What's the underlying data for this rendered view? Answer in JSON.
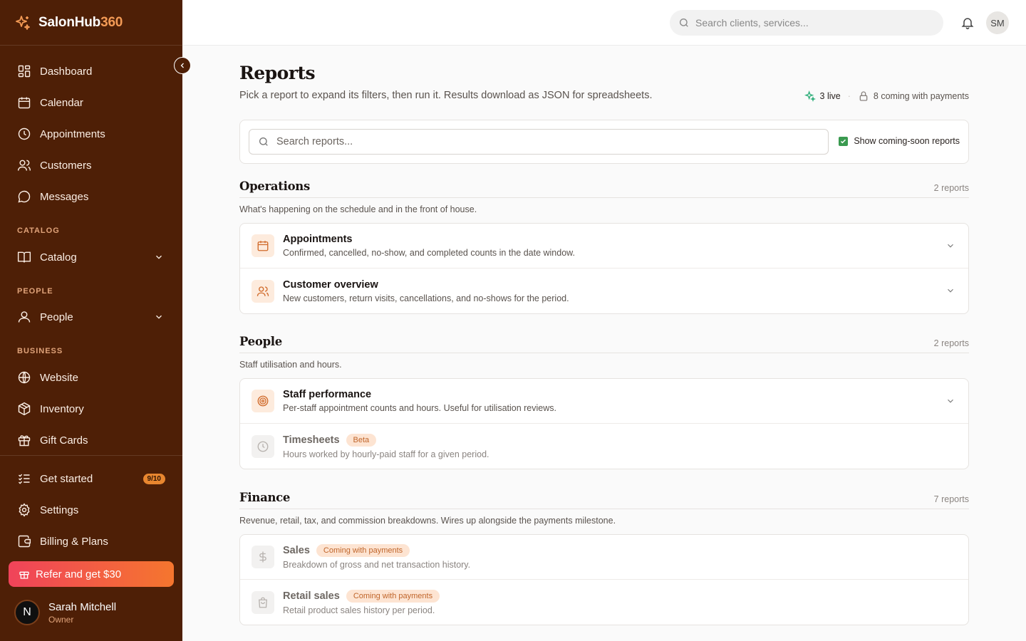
{
  "brand": {
    "name_main": "SalonHub",
    "name_accent": "360"
  },
  "sidebar": {
    "primary": [
      {
        "label": "Dashboard",
        "icon": "dashboard-icon"
      },
      {
        "label": "Calendar",
        "icon": "calendar-icon"
      },
      {
        "label": "Appointments",
        "icon": "clock-icon"
      },
      {
        "label": "Customers",
        "icon": "users-icon"
      },
      {
        "label": "Messages",
        "icon": "message-icon"
      }
    ],
    "sections": {
      "catalog": "CATALOG",
      "people": "PEOPLE",
      "business": "BUSINESS"
    },
    "catalog_item": "Catalog",
    "people_item": "People",
    "business_items": [
      {
        "label": "Website",
        "icon": "globe-icon"
      },
      {
        "label": "Inventory",
        "icon": "box-icon"
      },
      {
        "label": "Gift Cards",
        "icon": "gift-icon"
      }
    ],
    "bottom_items": [
      {
        "label": "Get started",
        "badge": "9/10"
      },
      {
        "label": "Settings"
      },
      {
        "label": "Billing & Plans"
      }
    ],
    "refer_label": "Refer and get $30",
    "user": {
      "initial": "N",
      "name": "Sarah Mitchell",
      "role": "Owner"
    }
  },
  "topbar": {
    "search_placeholder": "Search clients, services...",
    "avatar_initials": "SM"
  },
  "page": {
    "title": "Reports",
    "subtitle": "Pick a report to expand its filters, then run it. Results download as JSON for spreadsheets.",
    "live_count": "3 live",
    "coming_count": "8 coming with payments",
    "report_search_placeholder": "Search reports...",
    "show_coming_soon_label": "Show coming-soon reports"
  },
  "sections": [
    {
      "title": "Operations",
      "count": "2 reports",
      "desc": "What's happening on the schedule and in the front of house.",
      "reports": [
        {
          "title": "Appointments",
          "desc": "Confirmed, cancelled, no-show, and completed counts in the date window."
        },
        {
          "title": "Customer overview",
          "desc": "New customers, return visits, cancellations, and no-shows for the period."
        }
      ]
    },
    {
      "title": "People",
      "count": "2 reports",
      "desc": "Staff utilisation and hours.",
      "reports": [
        {
          "title": "Staff performance",
          "desc": "Per-staff appointment counts and hours. Useful for utilisation reviews."
        },
        {
          "title": "Timesheets",
          "badge": "Beta",
          "desc": "Hours worked by hourly-paid staff for a given period."
        }
      ]
    },
    {
      "title": "Finance",
      "count": "7 reports",
      "desc": "Revenue, retail, tax, and commission breakdowns. Wires up alongside the payments milestone.",
      "reports": [
        {
          "title": "Sales",
          "badge": "Coming with payments",
          "desc": "Breakdown of gross and net transaction history."
        },
        {
          "title": "Retail sales",
          "badge": "Coming with payments",
          "desc": "Retail product sales history per period."
        }
      ]
    }
  ],
  "colors": {
    "sidebar_bg": "#4e1f06",
    "accent": "#f39a55",
    "refer_gradient": [
      "#f0435a",
      "#f5762e"
    ],
    "live_icon": "#2fae7a"
  }
}
